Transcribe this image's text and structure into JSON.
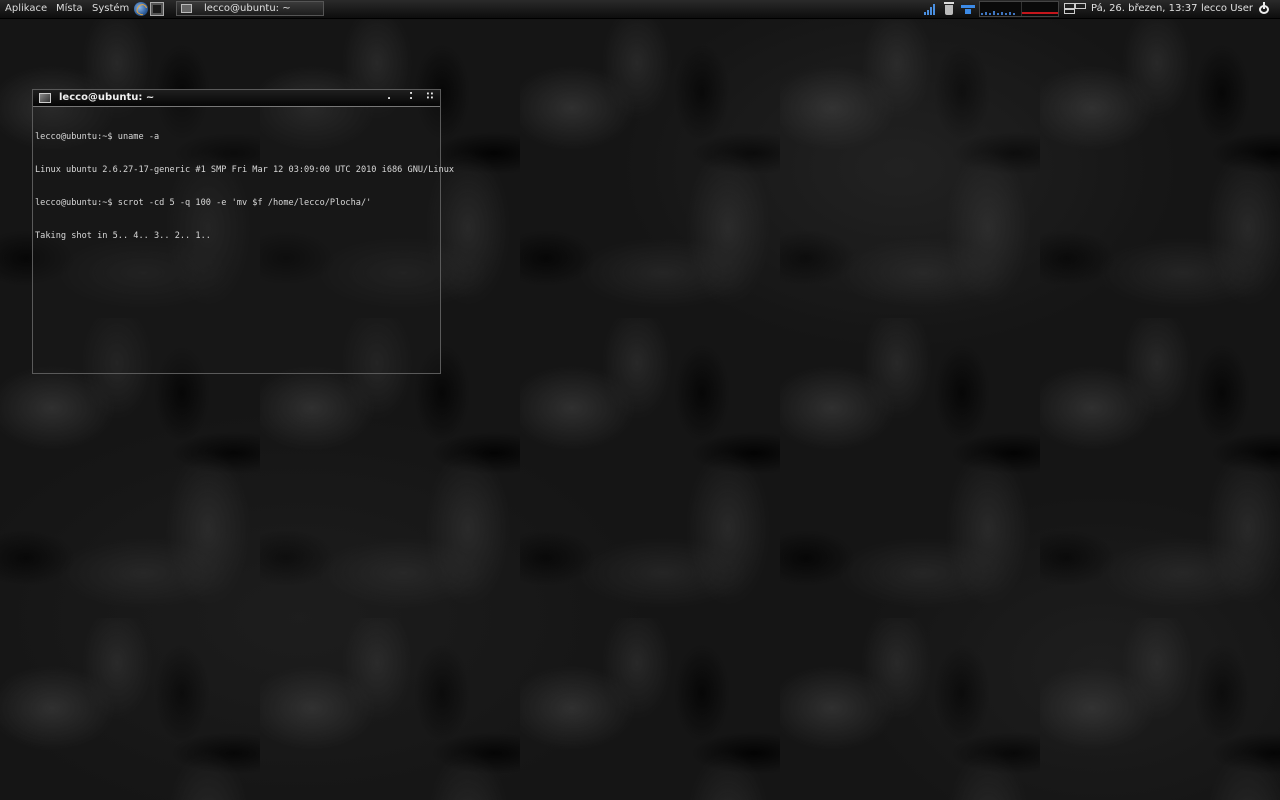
{
  "panel": {
    "menus": [
      "Aplikace",
      "Místa",
      "Systém"
    ],
    "launchers": [
      "browser-icon",
      "terminal-icon"
    ],
    "taskbar_item": "lecco@ubuntu: ~",
    "clock": "Pá, 26. březen, 13:37",
    "user": "lecco User",
    "tray_icons": [
      "signal-icon",
      "trash-icon",
      "network-icon",
      "load-graph",
      "workspace-icon",
      "power-icon"
    ]
  },
  "terminal": {
    "title": "lecco@ubuntu: ~",
    "buttons": {
      "minimize": ".",
      "maximize": "⁚",
      "close": "∷"
    },
    "lines": [
      "lecco@ubuntu:~$ uname -a",
      "Linux ubuntu 2.6.27-17-generic #1 SMP Fri Mar 12 03:09:00 UTC 2010 i686 GNU/Linux",
      "lecco@ubuntu:~$ scrot -cd 5 -q 100 -e 'mv $f /home/lecco/Plocha/'",
      "Taking shot in 5.. 4.. 3.. 2.. 1.."
    ]
  },
  "colors": {
    "panel_bg": "#1a1a1a",
    "text": "#dcdcdc",
    "accent_blue": "#3c8ae6",
    "net_red": "#c4161c"
  }
}
